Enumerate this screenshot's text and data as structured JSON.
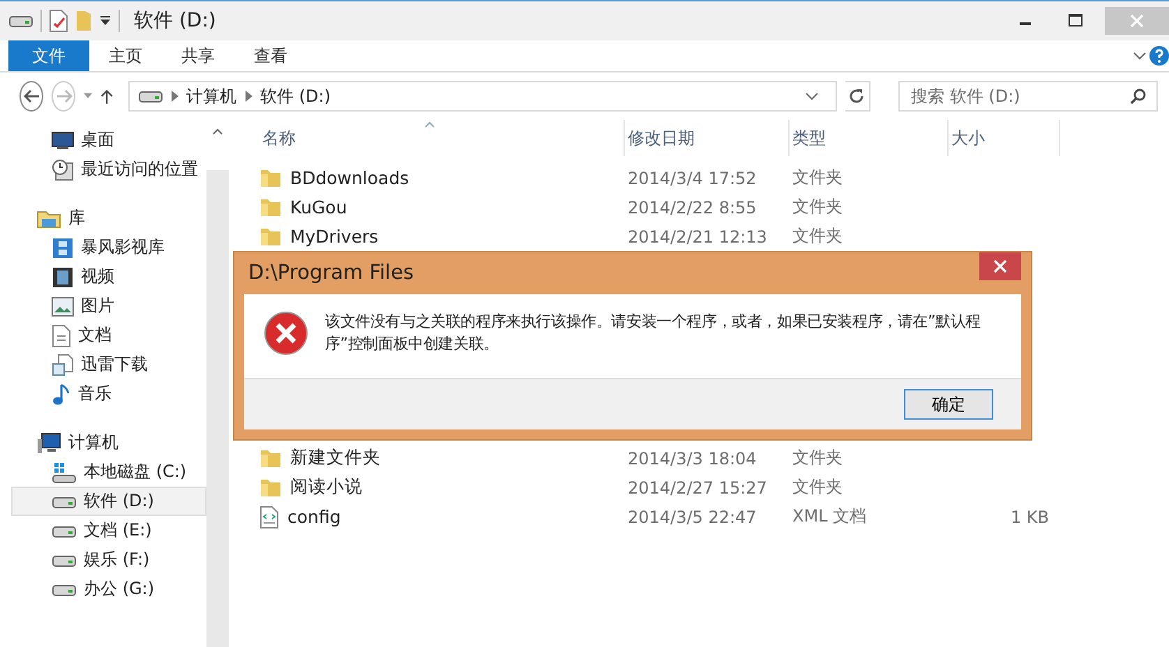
{
  "window": {
    "title": "软件 (D:)"
  },
  "ribbon_tabs": [
    {
      "label": "文件",
      "selected": true
    },
    {
      "label": "主页",
      "selected": false
    },
    {
      "label": "共享",
      "selected": false
    },
    {
      "label": "查看",
      "selected": false
    }
  ],
  "address": {
    "path": [
      "计算机",
      "软件 (D:)"
    ]
  },
  "search": {
    "placeholder": "搜索 软件 (D:)"
  },
  "nav": [
    {
      "items": [
        {
          "label": "桌面",
          "kind": "desktop",
          "selected": false
        },
        {
          "label": "最近访问的位置",
          "kind": "recent",
          "selected": false
        }
      ]
    },
    {
      "header": {
        "label": "库",
        "kind": "library"
      },
      "items": [
        {
          "label": "暴风影视库",
          "kind": "media",
          "selected": false
        },
        {
          "label": "视频",
          "kind": "video",
          "selected": false
        },
        {
          "label": "图片",
          "kind": "picture",
          "selected": false
        },
        {
          "label": "文档",
          "kind": "doc",
          "selected": false
        },
        {
          "label": "迅雷下载",
          "kind": "download",
          "selected": false
        },
        {
          "label": "音乐",
          "kind": "music",
          "selected": false
        }
      ]
    },
    {
      "header": {
        "label": "计算机",
        "kind": "computer"
      },
      "items": [
        {
          "label": "本地磁盘 (C:)",
          "kind": "system-drive",
          "selected": false
        },
        {
          "label": "软件 (D:)",
          "kind": "drive",
          "selected": true
        },
        {
          "label": "文档 (E:)",
          "kind": "drive",
          "selected": false
        },
        {
          "label": "娱乐 (F:)",
          "kind": "drive",
          "selected": false
        },
        {
          "label": "办公 (G:)",
          "kind": "drive",
          "selected": false
        }
      ]
    }
  ],
  "columns": [
    {
      "label": "名称",
      "sorted": true
    },
    {
      "label": "修改日期",
      "sorted": false
    },
    {
      "label": "类型",
      "sorted": false
    },
    {
      "label": "大小",
      "sorted": false
    }
  ],
  "rows_above_dialog": [
    {
      "kind": "folder",
      "name": "BDdownloads",
      "date": "2014/3/4 17:52",
      "type": "文件夹"
    },
    {
      "kind": "folder",
      "name": "KuGou",
      "date": "2014/2/22 8:55",
      "type": "文件夹"
    },
    {
      "kind": "folder",
      "name": "MyDrivers",
      "date": "2014/2/21 12:13",
      "type": "文件夹"
    }
  ],
  "rows_below_dialog": [
    {
      "kind": "folder",
      "name": "新建文件夹",
      "date": "2014/3/3 18:04",
      "type": "文件夹"
    },
    {
      "kind": "folder",
      "name": "阅读小说",
      "date": "2014/2/27 15:27",
      "type": "文件夹"
    },
    {
      "kind": "file",
      "name": "config",
      "date": "2014/3/5 22:47",
      "type": "XML 文档",
      "size": "1 KB"
    }
  ],
  "dialog": {
    "title": "D:\\Program Files",
    "message": "该文件没有与之关联的程序来执行该操作。请安装一个程序，或者，如果已安装程序，请在”默认程序”控制面板中创建关联。",
    "button": "确定"
  }
}
